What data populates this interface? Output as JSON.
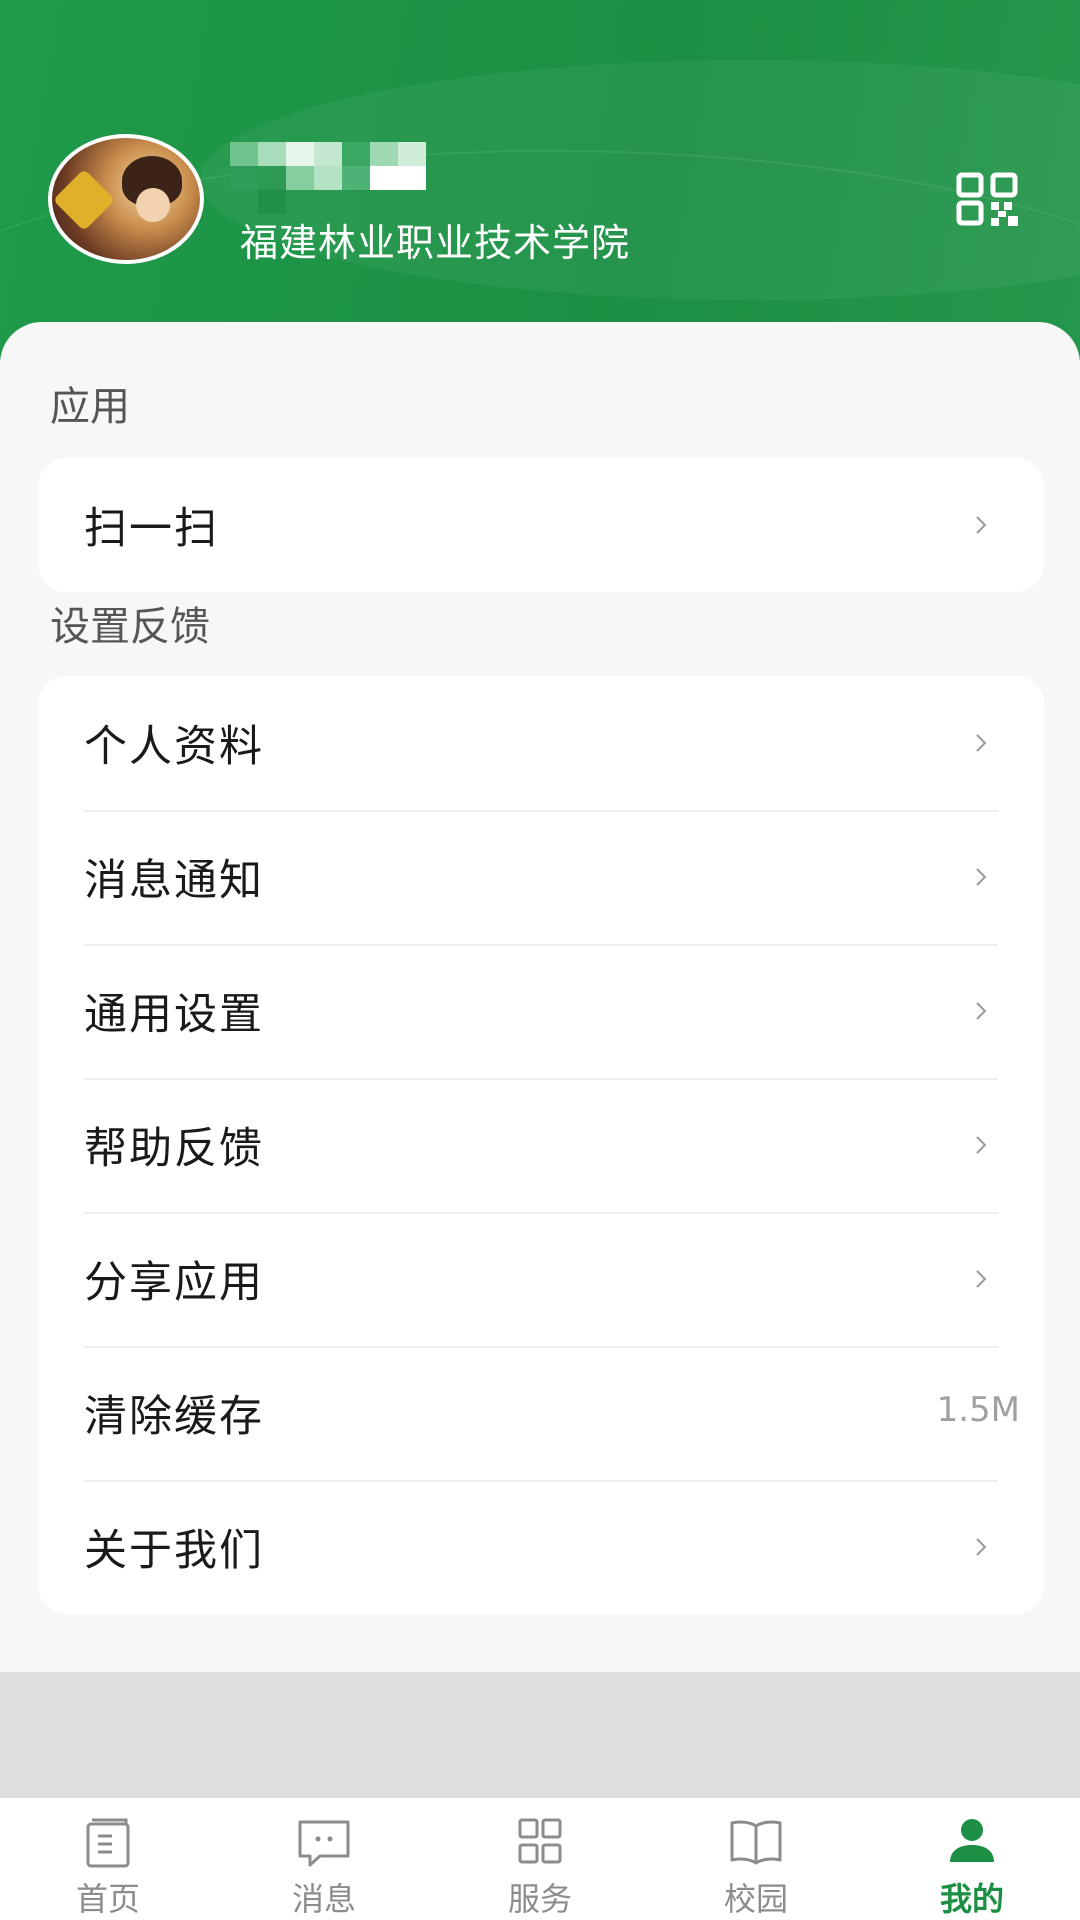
{
  "header": {
    "school_name": "福建林业职业技术学院",
    "accent_color": "#1e9346"
  },
  "sections": {
    "apps_title": "应用",
    "settings_title": "设置反馈"
  },
  "apps": [
    {
      "label": "扫一扫",
      "icon": "chevron-right-icon"
    }
  ],
  "settings": [
    {
      "label": "个人资料"
    },
    {
      "label": "消息通知"
    },
    {
      "label": "通用设置"
    },
    {
      "label": "帮助反馈"
    },
    {
      "label": "分享应用"
    },
    {
      "label": "清除缓存",
      "value": "1.5M"
    },
    {
      "label": "关于我们"
    }
  ],
  "tabbar": [
    {
      "label": "首页",
      "icon": "home-document-icon"
    },
    {
      "label": "消息",
      "icon": "message-bubble-icon"
    },
    {
      "label": "服务",
      "icon": "grid-services-icon"
    },
    {
      "label": "校园",
      "icon": "open-book-icon"
    },
    {
      "label": "我的",
      "icon": "user-profile-icon",
      "active": true
    }
  ]
}
